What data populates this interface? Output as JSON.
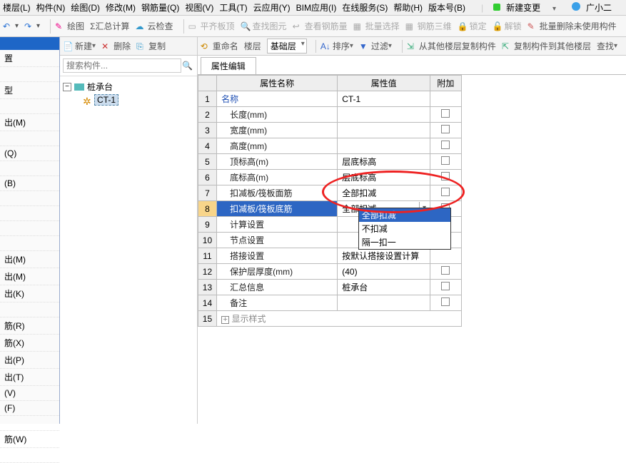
{
  "menubar": {
    "items": [
      "楼层(L)",
      "构件(N)",
      "绘图(D)",
      "修改(M)",
      "钢筋量(Q)",
      "视图(V)",
      "工具(T)",
      "云应用(Y)",
      "BIM应用(I)",
      "在线服务(S)",
      "帮助(H)",
      "版本号(B)"
    ],
    "newchange": "新建变更",
    "assistant": "广小二"
  },
  "toolbar1": {
    "draw": "绘图",
    "sum": "汇总计算",
    "cloud": "云检查",
    "flat": "平齐板顶",
    "findelem": "查找图元",
    "viewrebar": "查看钢筋量",
    "batchsel": "批量选择",
    "rebar3d": "钢筋三维",
    "lock": "锁定",
    "unlock": "解锁",
    "batchdel": "批量删除未使用构件"
  },
  "leftcol": {
    "items": [
      "置",
      "",
      "型",
      "",
      "出(M)",
      "",
      "(Q)",
      "",
      "(B)",
      "",
      "",
      "",
      "",
      "出(M)",
      "出(M)",
      "出(K)",
      "",
      "筋(R)",
      "筋(X)",
      "出(P)",
      "出(T)",
      "(V)",
      "(F)",
      "",
      "筋(W)",
      ""
    ]
  },
  "toolbar2": {
    "new": "新建",
    "del": "删除",
    "copy": "复制",
    "rename": "重命名",
    "floor": "楼层"
  },
  "search": {
    "placeholder": "搜索构件..."
  },
  "tree": {
    "root": "桩承台",
    "child": "CT-1"
  },
  "toolbar3": {
    "floor_sel": "基础层",
    "sort": "排序",
    "filter": "过滤",
    "copyfrom": "从其他楼层复制构件",
    "copyto": "复制构件到其他楼层",
    "find": "查找"
  },
  "tab": {
    "label": "属性编辑"
  },
  "grid": {
    "col_name": "属性名称",
    "col_value": "属性值",
    "col_extra": "附加",
    "rows": [
      {
        "n": "1",
        "name": "名称",
        "val": "CT-1",
        "blue": true
      },
      {
        "n": "2",
        "name": "长度(mm)",
        "val": "",
        "indent": true,
        "chk": true
      },
      {
        "n": "3",
        "name": "宽度(mm)",
        "val": "",
        "indent": true,
        "chk": true
      },
      {
        "n": "4",
        "name": "高度(mm)",
        "val": "",
        "indent": true,
        "chk": true
      },
      {
        "n": "5",
        "name": "顶标高(m)",
        "val": "层底标高",
        "indent": true,
        "chk": true
      },
      {
        "n": "6",
        "name": "底标高(m)",
        "val": "层底标高",
        "indent": true,
        "chk": true
      },
      {
        "n": "7",
        "name": "扣减板/筏板面筋",
        "val": "全部扣减",
        "indent": true,
        "chk": true
      },
      {
        "n": "8",
        "name": "扣减板/筏板底筋",
        "val": "全部扣减",
        "indent": true,
        "sel": true,
        "chk": true,
        "dd": true
      },
      {
        "n": "9",
        "name": "计算设置",
        "val": "",
        "indent": true
      },
      {
        "n": "10",
        "name": "节点设置",
        "val": "",
        "indent": true
      },
      {
        "n": "11",
        "name": "搭接设置",
        "val": "按默认搭接设置计算",
        "indent": true
      },
      {
        "n": "12",
        "name": "保护层厚度(mm)",
        "val": "(40)",
        "indent": true,
        "chk": true
      },
      {
        "n": "13",
        "name": "汇总信息",
        "val": "桩承台",
        "indent": true,
        "chk": true
      },
      {
        "n": "14",
        "name": "备注",
        "val": "",
        "indent": true,
        "chk": true
      },
      {
        "n": "15",
        "name": "显示样式",
        "val": "",
        "plus": true
      }
    ]
  },
  "dropdown": {
    "sel": "全部扣减",
    "opts": [
      "不扣减",
      "隔一扣一"
    ]
  }
}
